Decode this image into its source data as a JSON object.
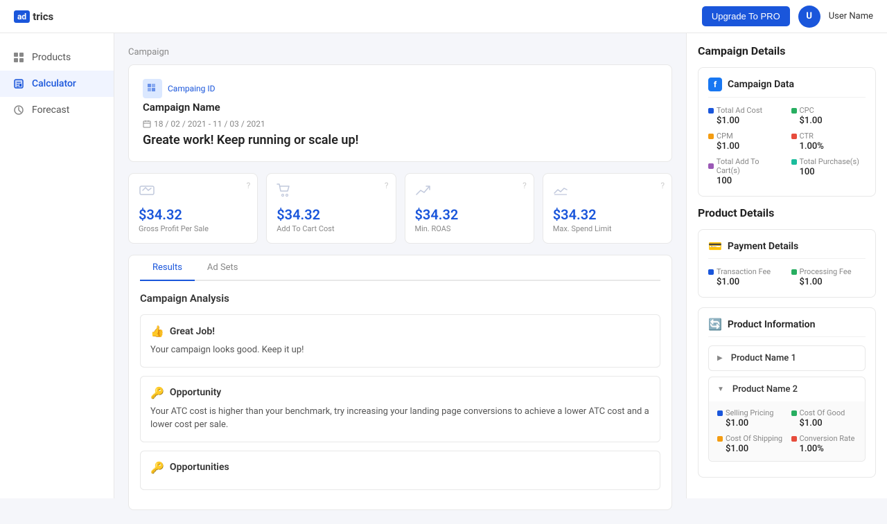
{
  "header": {
    "logo_ad": "ad",
    "logo_trics": "trics",
    "upgrade_label": "Upgrade To PRO",
    "user_avatar": "U",
    "user_name": "User Name"
  },
  "sidebar": {
    "items": [
      {
        "id": "products",
        "label": "Products",
        "active": false
      },
      {
        "id": "calculator",
        "label": "Calculator",
        "active": true
      },
      {
        "id": "forecast",
        "label": "Forecast",
        "active": false
      }
    ]
  },
  "main": {
    "page_label": "Campaign",
    "campaign": {
      "id_label": "Campaing ID",
      "name": "Campaign Name",
      "date_range": "18 / 02 / 2021  -  11 / 03 / 2021",
      "headline": "Greate work! Keep running or scale up!"
    },
    "stats": [
      {
        "value": "$34.32",
        "label": "Gross Profit Per Sale"
      },
      {
        "value": "$34.32",
        "label": "Add To Cart Cost"
      },
      {
        "value": "$34.32",
        "label": "Min. ROAS"
      },
      {
        "value": "$34.32",
        "label": "Max. Spend Limit"
      }
    ],
    "tabs": [
      {
        "label": "Results",
        "active": true
      },
      {
        "label": "Ad Sets",
        "active": false
      }
    ],
    "analysis": {
      "title": "Campaign Analysis",
      "items": [
        {
          "type": "good",
          "heading": "Great Job!",
          "text": "Your campaign looks good. Keep it up!"
        },
        {
          "type": "opportunity",
          "heading": "Opportunity",
          "text": "Your ATC cost is higher than your benchmark, try increasing your landing page conversions to achieve a lower ATC cost and a lower cost per sale."
        },
        {
          "type": "opportunities",
          "heading": "Opportunities",
          "text": ""
        }
      ]
    }
  },
  "right_panel": {
    "campaign_details_title": "Campaign Details",
    "campaign_data": {
      "card_title": "Campaign Data",
      "metrics": [
        {
          "label": "Total Ad Cost",
          "value": "$1.00",
          "dot": "blue"
        },
        {
          "label": "CPC",
          "value": "$1.00",
          "dot": "green"
        },
        {
          "label": "CPM",
          "value": "$1.00",
          "dot": "orange"
        },
        {
          "label": "CTR",
          "value": "1.00%",
          "dot": "red"
        },
        {
          "label": "Total Add To Cart(s)",
          "value": "100",
          "dot": "purple"
        },
        {
          "label": "Total Purchase(s)",
          "value": "100",
          "dot": "teal"
        }
      ]
    },
    "product_details_title": "Product Details",
    "payment_details": {
      "card_title": "Payment Details",
      "metrics": [
        {
          "label": "Transaction Fee",
          "value": "$1.00",
          "dot": "blue"
        },
        {
          "label": "Processing Fee",
          "value": "$1.00",
          "dot": "green"
        }
      ]
    },
    "product_information": {
      "card_title": "Product Information",
      "products": [
        {
          "name": "Product Name 1",
          "expanded": false
        },
        {
          "name": "Product Name 2",
          "expanded": true,
          "details": [
            {
              "label": "Selling Pricing",
              "value": "$1.00",
              "dot": "blue"
            },
            {
              "label": "Cost Of Good",
              "value": "$1.00",
              "dot": "green"
            },
            {
              "label": "Cost Of Shipping",
              "value": "$1.00",
              "dot": "orange"
            },
            {
              "label": "Conversion Rate",
              "value": "1.00%",
              "dot": "red"
            }
          ]
        }
      ]
    }
  }
}
